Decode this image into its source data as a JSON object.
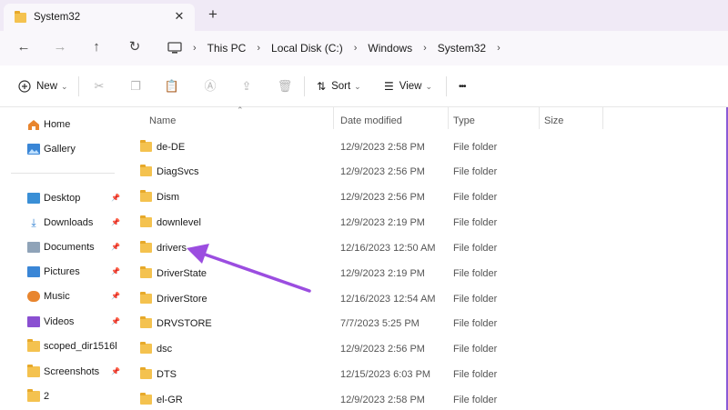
{
  "window": {
    "tab_title": "System32",
    "new_tab_glyph": "+",
    "close_glyph": "✕"
  },
  "nav": {
    "back_glyph": "←",
    "forward_glyph": "→",
    "up_glyph": "↑",
    "refresh_glyph": "↻",
    "breadcrumb": [
      "This PC",
      "Local Disk (C:)",
      "Windows",
      "System32"
    ],
    "separator": "›"
  },
  "toolbar": {
    "new_label": "New",
    "sort_label": "Sort",
    "view_label": "View",
    "more_glyph": "•••",
    "dropdown_glyph": "⌄"
  },
  "sidebar": {
    "top_items": [
      {
        "label": "Home",
        "icon": "home-icon"
      },
      {
        "label": "Gallery",
        "icon": "gallery-icon"
      }
    ],
    "pinned_items": [
      {
        "label": "Desktop",
        "icon": "desktop-icon",
        "pinned": true
      },
      {
        "label": "Downloads",
        "icon": "downloads-icon",
        "pinned": true
      },
      {
        "label": "Documents",
        "icon": "documents-icon",
        "pinned": true
      },
      {
        "label": "Pictures",
        "icon": "pictures-icon",
        "pinned": true
      },
      {
        "label": "Music",
        "icon": "music-icon",
        "pinned": true
      },
      {
        "label": "Videos",
        "icon": "videos-icon",
        "pinned": true
      },
      {
        "label": "scoped_dir1516l",
        "icon": "folder-icon",
        "pinned": false
      },
      {
        "label": "Screenshots",
        "icon": "folder-icon",
        "pinned": true
      },
      {
        "label": "2",
        "icon": "folder-icon",
        "pinned": false
      }
    ]
  },
  "columns": {
    "name": "Name",
    "date": "Date modified",
    "type": "Type",
    "size": "Size"
  },
  "files": [
    {
      "name": "de-DE",
      "date": "12/9/2023 2:58 PM",
      "type": "File folder"
    },
    {
      "name": "DiagSvcs",
      "date": "12/9/2023 2:56 PM",
      "type": "File folder"
    },
    {
      "name": "Dism",
      "date": "12/9/2023 2:56 PM",
      "type": "File folder"
    },
    {
      "name": "downlevel",
      "date": "12/9/2023 2:19 PM",
      "type": "File folder"
    },
    {
      "name": "drivers",
      "date": "12/16/2023 12:50 AM",
      "type": "File folder"
    },
    {
      "name": "DriverState",
      "date": "12/9/2023 2:19 PM",
      "type": "File folder"
    },
    {
      "name": "DriverStore",
      "date": "12/16/2023 12:54 AM",
      "type": "File folder"
    },
    {
      "name": "DRVSTORE",
      "date": "7/7/2023 5:25 PM",
      "type": "File folder"
    },
    {
      "name": "dsc",
      "date": "12/9/2023 2:56 PM",
      "type": "File folder"
    },
    {
      "name": "DTS",
      "date": "12/15/2023 6:03 PM",
      "type": "File folder"
    },
    {
      "name": "el-GR",
      "date": "12/9/2023 2:58 PM",
      "type": "File folder"
    }
  ],
  "colors": {
    "accent": "#9b4de0",
    "folder": "#f4c24f",
    "tabbar_bg": "#f0eaf6"
  }
}
